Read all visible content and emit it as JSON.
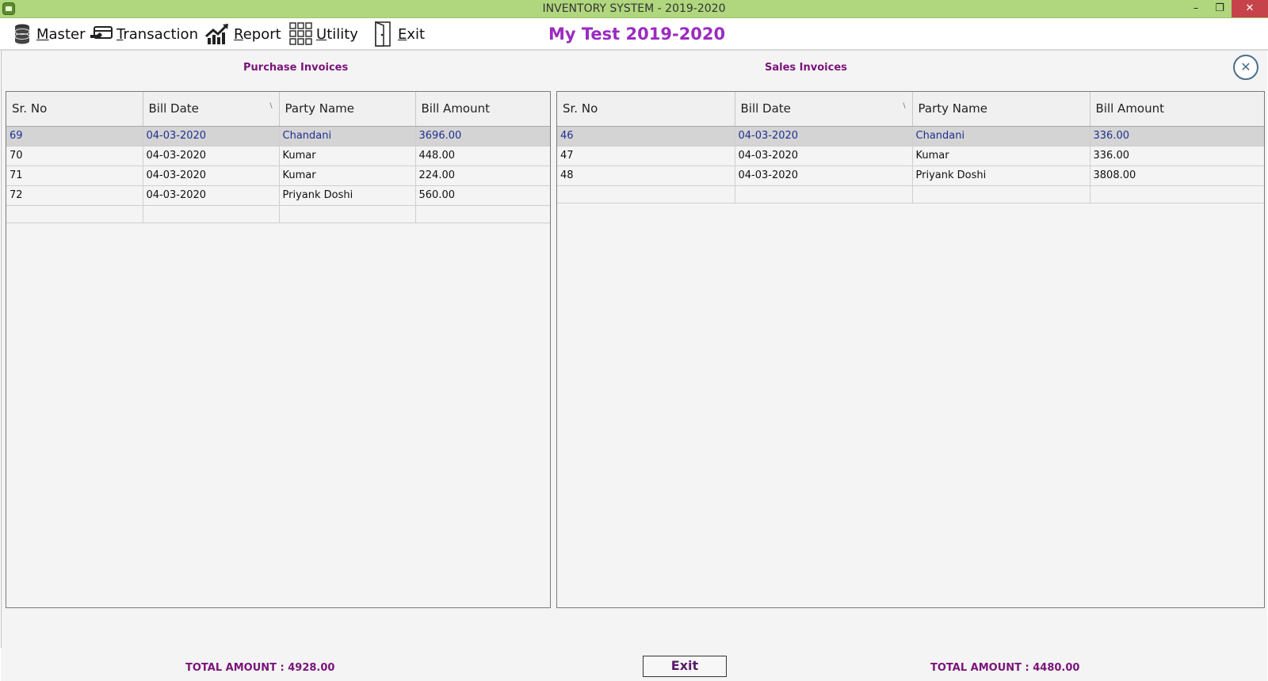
{
  "window": {
    "title": "INVENTORY SYSTEM - 2019-2020",
    "minimize_glyph": "–",
    "maximize_glyph": "❐",
    "close_glyph": "✕"
  },
  "menu": {
    "items": [
      {
        "label": "Master",
        "icon": "database-icon"
      },
      {
        "label": "Transaction",
        "icon": "card-payment-icon"
      },
      {
        "label": "Report",
        "icon": "chart-growth-icon"
      },
      {
        "label": "Utility",
        "icon": "grid-apps-icon"
      },
      {
        "label": "Exit",
        "icon": "door-exit-icon"
      }
    ],
    "company": "My Test 2019-2020"
  },
  "purchase": {
    "title": "Purchase Invoices",
    "columns": [
      "Sr. No",
      "Bill Date",
      "Party Name",
      "Bill Amount"
    ],
    "rows": [
      [
        "69",
        "04-03-2020",
        "Chandani",
        "3696.00"
      ],
      [
        "70",
        "04-03-2020",
        "Kumar",
        "448.00"
      ],
      [
        "71",
        "04-03-2020",
        "Kumar",
        "224.00"
      ],
      [
        "72",
        "04-03-2020",
        "Priyank Doshi",
        "560.00"
      ]
    ],
    "total": "TOTAL AMOUNT : 4928.00"
  },
  "sales": {
    "title": "Sales Invoices",
    "columns": [
      "Sr. No",
      "Bill Date",
      "Party Name",
      "Bill Amount"
    ],
    "rows": [
      [
        "46",
        "04-03-2020",
        "Chandani",
        "336.00"
      ],
      [
        "47",
        "04-03-2020",
        "Kumar",
        "336.00"
      ],
      [
        "48",
        "04-03-2020",
        "Priyank Doshi",
        "3808.00"
      ]
    ],
    "total": "TOTAL AMOUNT : 4480.00"
  },
  "footer": {
    "exit_label": "Exit"
  },
  "colors": {
    "titlebar": "#b0d77e",
    "accent_purple": "#9b2bc0",
    "label_purple": "#7a147a",
    "selected_row": "#d4d4d4"
  }
}
